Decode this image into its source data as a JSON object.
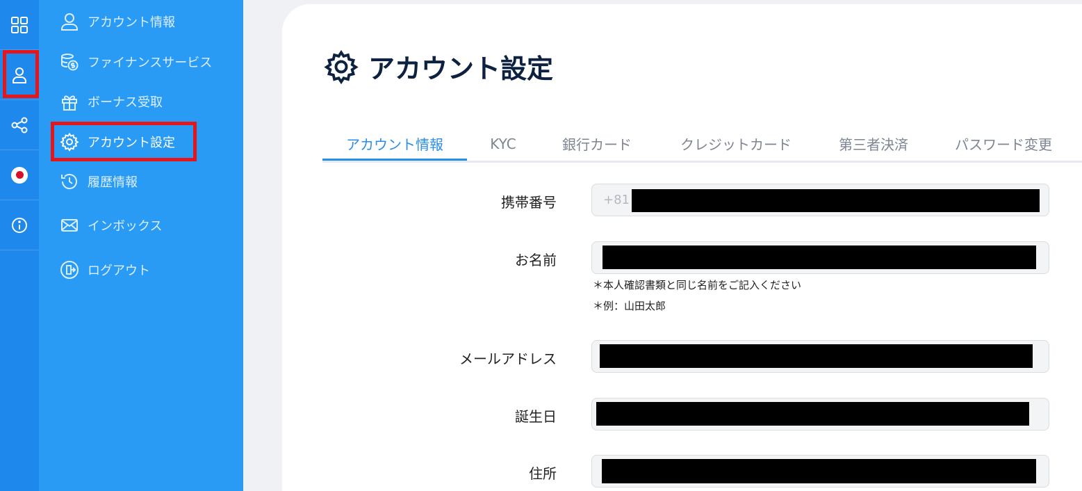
{
  "rail": {
    "items": [
      {
        "icon": "grid-icon"
      },
      {
        "icon": "user-icon"
      },
      {
        "icon": "share-icon"
      },
      {
        "icon": "japan-flag-icon"
      },
      {
        "icon": "info-icon"
      }
    ]
  },
  "sidebar": {
    "items": [
      {
        "label": "アカウント情報",
        "icon": "user-icon"
      },
      {
        "label": "ファイナンスサービス",
        "icon": "coins-icon"
      },
      {
        "label": "ボーナス受取",
        "icon": "gift-icon"
      },
      {
        "label": "アカウント設定",
        "icon": "gear-icon",
        "active": true
      },
      {
        "label": "履歴情報",
        "icon": "history-icon"
      },
      {
        "label": "インボックス",
        "icon": "mail-icon"
      },
      {
        "label": "ログアウト",
        "icon": "logout-icon"
      }
    ]
  },
  "page": {
    "title": "アカウント設定"
  },
  "tabs": [
    {
      "label": "アカウント情報",
      "active": true
    },
    {
      "label": "KYC"
    },
    {
      "label": "銀行カード"
    },
    {
      "label": "クレジットカード"
    },
    {
      "label": "第三者決済"
    },
    {
      "label": "パスワード変更"
    }
  ],
  "form": {
    "phone": {
      "label": "携帯番号",
      "prefix": "+81"
    },
    "name": {
      "label": "お名前",
      "note1": "＊本人確認書類と同じ名前をご記入ください",
      "note2": "＊例：山田太郎"
    },
    "email": {
      "label": "メールアドレス"
    },
    "birthday": {
      "label": "誕生日"
    },
    "address": {
      "label": "住所"
    }
  },
  "colors": {
    "rail": "#1e88ec",
    "sidebar": "#2a9bf5",
    "accent": "#2a8ee6",
    "highlight": "#e5151a",
    "title": "#0d2240"
  }
}
